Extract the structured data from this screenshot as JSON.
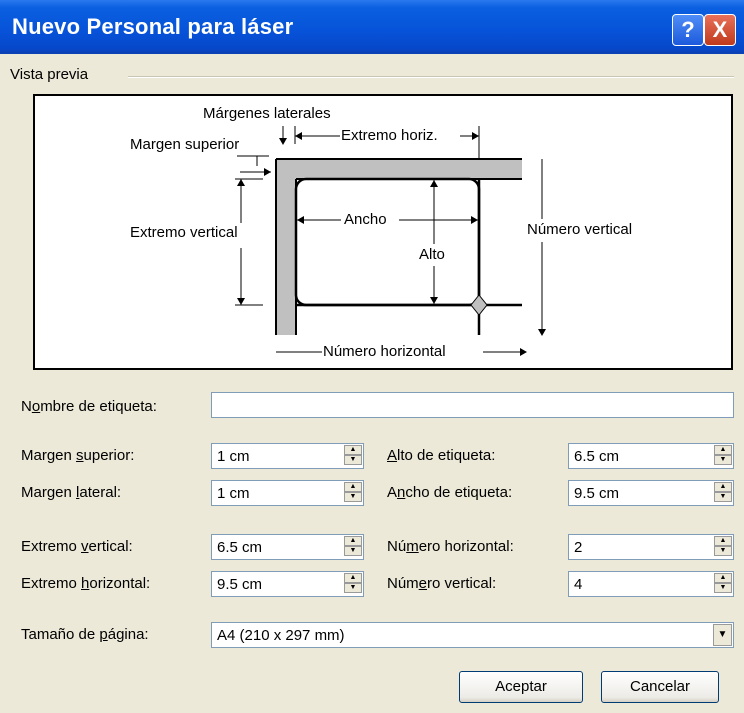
{
  "window": {
    "title": "Nuevo Personal para láser"
  },
  "titlebar_buttons": {
    "help": "?",
    "close": "X"
  },
  "group": {
    "title": "Vista previa"
  },
  "preview": {
    "margenes_laterales": "Márgenes laterales",
    "margen_superior": "Margen superior",
    "extremo_horiz": "Extremo horiz.",
    "extremo_vertical": "Extremo vertical",
    "ancho": "Ancho",
    "alto": "Alto",
    "numero_vertical": "Número vertical",
    "numero_horizontal": "Número horizontal"
  },
  "form": {
    "nombre": {
      "label_pre": "N",
      "label_u": "o",
      "label_post": "mbre de etiqueta:",
      "value": ""
    },
    "margen_superior": {
      "label_pre": "Margen ",
      "label_u": "s",
      "label_post": "uperior:",
      "value": "1 cm"
    },
    "margen_lateral": {
      "label_pre": "Margen ",
      "label_u": "l",
      "label_post": "ateral:",
      "value": "1 cm"
    },
    "extremo_vertical": {
      "label_pre": "Extremo ",
      "label_u": "v",
      "label_post": "ertical:",
      "value": "6.5 cm"
    },
    "extremo_horizontal": {
      "label_pre": "Extremo ",
      "label_u": "h",
      "label_post": "orizontal:",
      "value": "9.5 cm"
    },
    "alto_etiqueta": {
      "label_pre": "",
      "label_u": "A",
      "label_post": "lto de etiqueta:",
      "value": "6.5 cm"
    },
    "ancho_etiqueta": {
      "label_pre": "A",
      "label_u": "n",
      "label_post": "cho de etiqueta:",
      "value": "9.5 cm"
    },
    "numero_horizontal": {
      "label_pre": "Nú",
      "label_u": "m",
      "label_post": "ero horizontal:",
      "value": "2"
    },
    "numero_vertical": {
      "label_pre": "Núm",
      "label_u": "e",
      "label_post": "ro vertical:",
      "value": "4"
    },
    "tamano_pagina": {
      "label_pre": "Tamaño de ",
      "label_u": "p",
      "label_post": "ágina:",
      "value": "A4 (210 x 297 mm)"
    }
  },
  "buttons": {
    "ok": "Aceptar",
    "cancel": "Cancelar"
  },
  "spinner": {
    "up": "▲",
    "down": "▼"
  },
  "select_arrow": "▼"
}
